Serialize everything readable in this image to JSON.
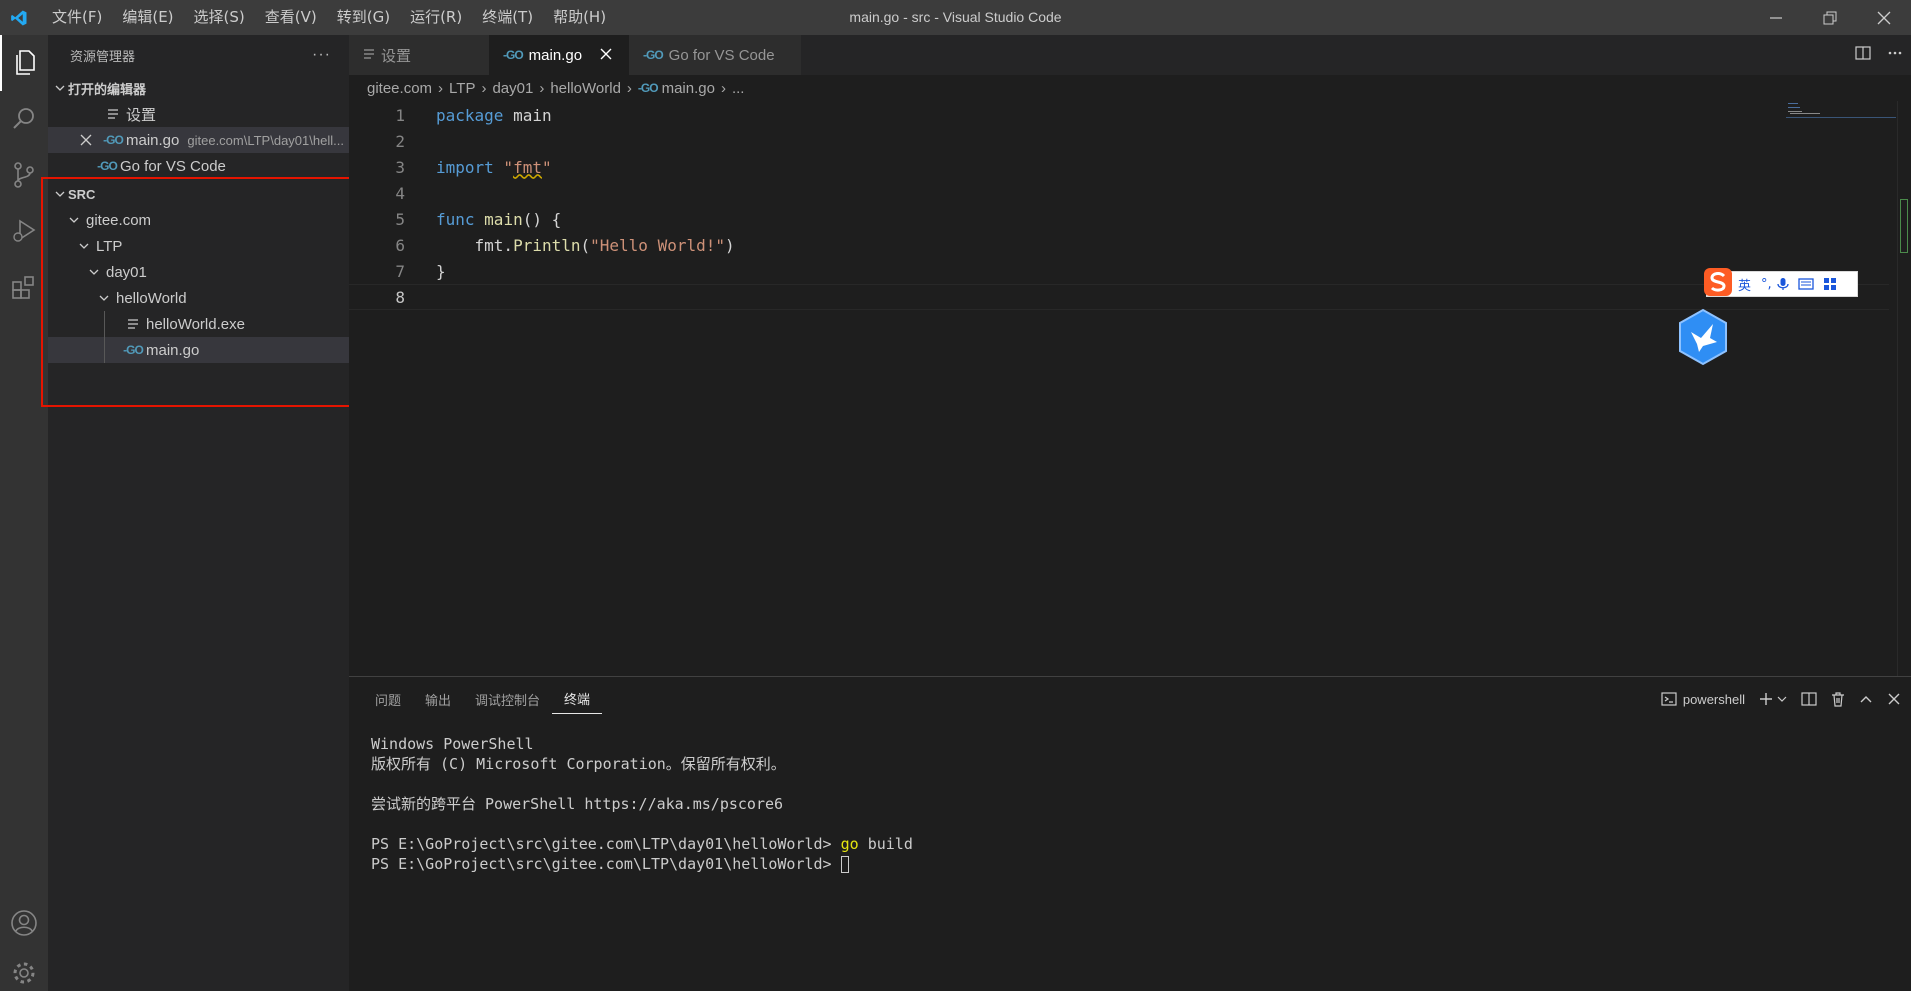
{
  "window": {
    "title": "main.go - src - Visual Studio Code",
    "menu": [
      "文件(F)",
      "编辑(E)",
      "选择(S)",
      "查看(V)",
      "转到(G)",
      "运行(R)",
      "终端(T)",
      "帮助(H)"
    ]
  },
  "sidebar": {
    "header": "资源管理器",
    "more": "···",
    "open_editors": {
      "label": "打开的编辑器",
      "items": [
        {
          "name": "设置",
          "desc": ""
        },
        {
          "name": "main.go",
          "desc": "gitee.com\\LTP\\day01\\hell..."
        },
        {
          "name": "Go for VS Code",
          "desc": ""
        }
      ]
    },
    "folder": {
      "label": "SRC",
      "tree": [
        "gitee.com",
        "LTP",
        "day01",
        "helloWorld",
        "helloWorld.exe",
        "main.go"
      ]
    }
  },
  "tabs": [
    {
      "label": "设置"
    },
    {
      "label": "main.go"
    },
    {
      "label": "Go for VS Code"
    }
  ],
  "breadcrumb": [
    "gitee.com",
    "LTP",
    "day01",
    "helloWorld",
    "main.go",
    "..."
  ],
  "editor": {
    "line_numbers": [
      "1",
      "2",
      "3",
      "4",
      "5",
      "6",
      "7",
      "8"
    ],
    "current_line": "8",
    "code": {
      "l1_kw": "package",
      "l1_rest": " main",
      "l3_kw": "import",
      "l3_q1": " \"",
      "l3_str": "fmt",
      "l3_q2": "\"",
      "l5_kw": "func",
      "l5_sp": " ",
      "l5_fn": "main",
      "l5_rest": "() {",
      "l6_indent": "    ",
      "l6_pkg": "fmt.",
      "l6_fn": "Println",
      "l6_open": "(",
      "l6_str": "\"Hello World!\"",
      "l6_close": ")",
      "l7": "}"
    }
  },
  "ime": {
    "lang": "英",
    "punct": "°,"
  },
  "panel": {
    "tabs": [
      "问题",
      "输出",
      "调试控制台",
      "终端"
    ],
    "active_tab": "终端",
    "shell": "powershell",
    "terminal": {
      "l1": "Windows PowerShell",
      "l2": "版权所有 (C) Microsoft Corporation。保留所有权利。",
      "l3": "尝试新的跨平台 PowerShell https://aka.ms/pscore6",
      "prompt": "PS E:\\GoProject\\src\\gitee.com\\LTP\\day01\\helloWorld>",
      "cmd_go": "go",
      "cmd_rest": " build"
    }
  },
  "colors": {
    "accent": "#007acc",
    "highlight_box": "#e51400",
    "keyword": "#569cd6",
    "string": "#ce9178",
    "function": "#dcdcaa",
    "go_icon": "#519aba"
  }
}
